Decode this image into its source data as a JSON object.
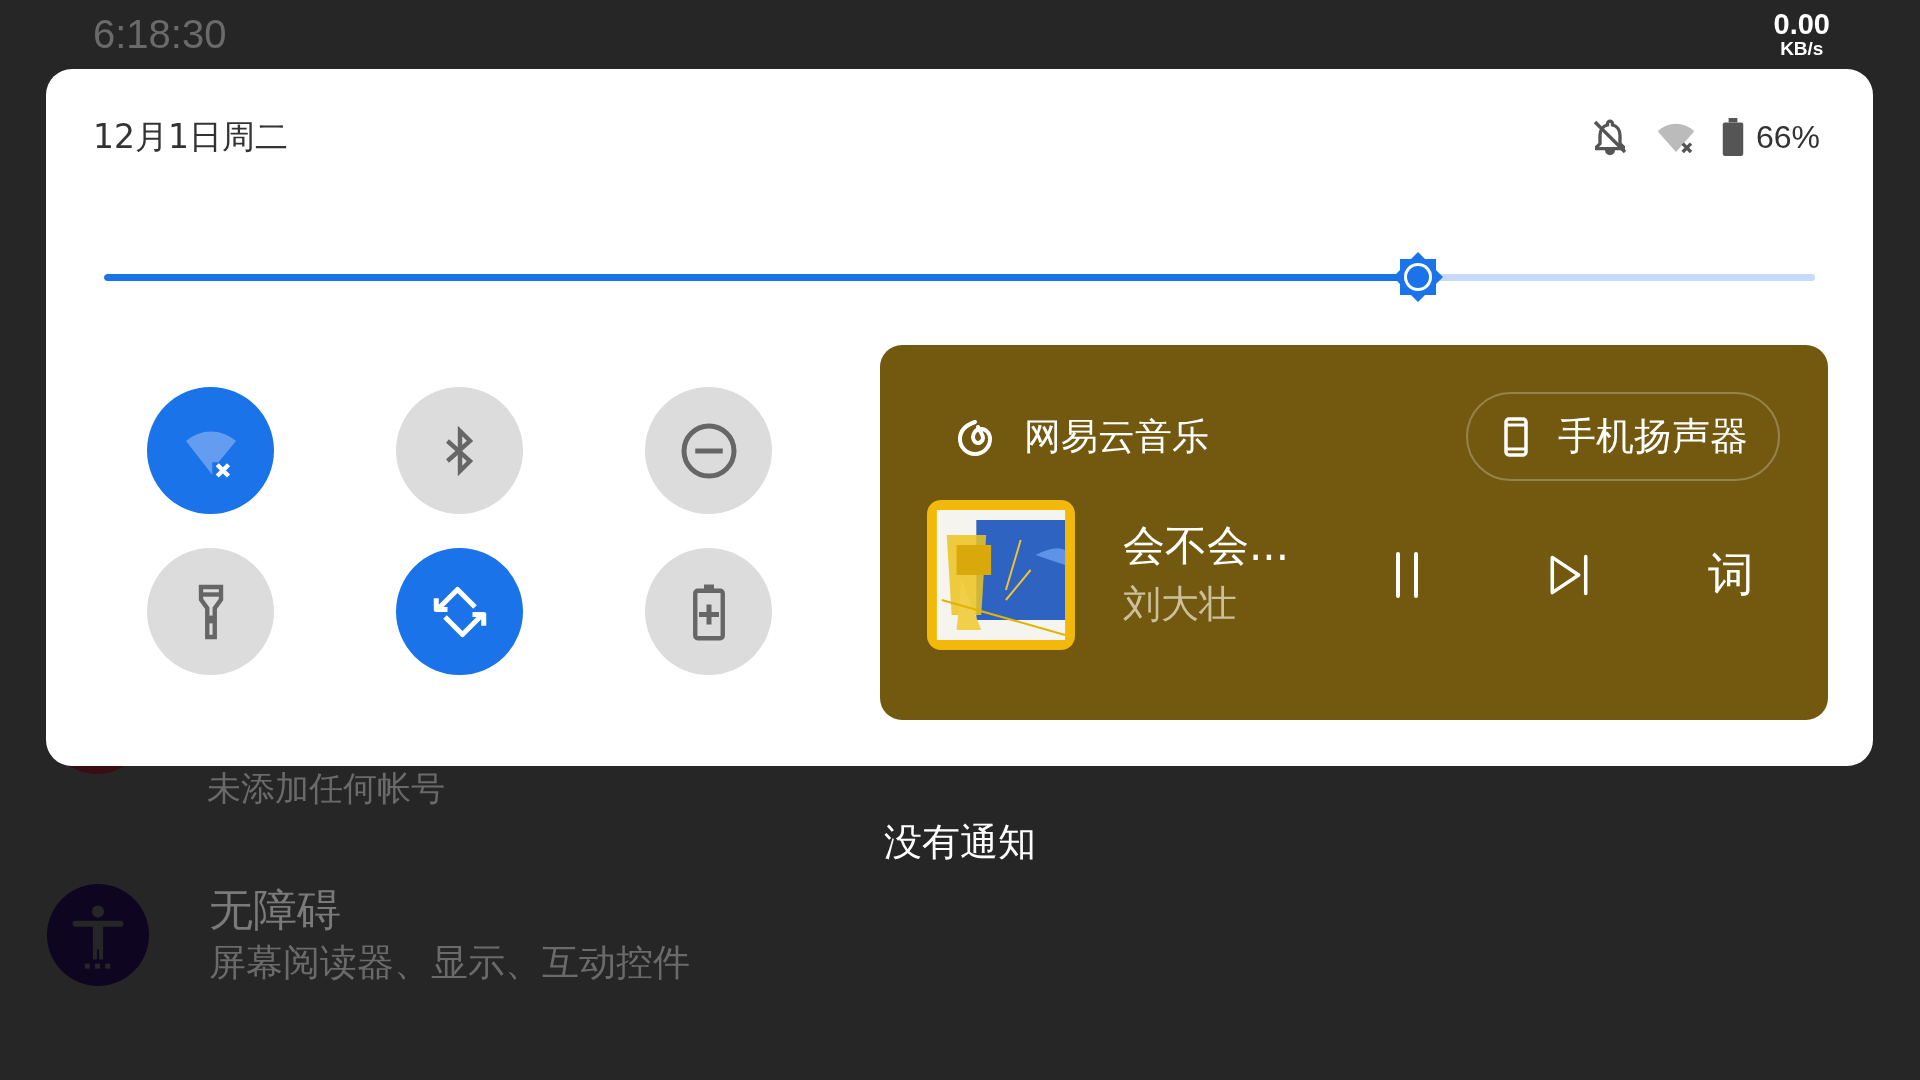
{
  "status_bar": {
    "time": "6:18:30",
    "net_speed": {
      "value": "0.00",
      "unit": "KB/s"
    }
  },
  "quick_settings": {
    "date": "12月1日周二",
    "battery_text": "66%",
    "brightness": {
      "level": 0.768
    },
    "tiles": [
      {
        "kind": "wifi",
        "on": true
      },
      {
        "kind": "bluetooth",
        "on": false
      },
      {
        "kind": "do-not-disturb",
        "on": false
      },
      {
        "kind": "flashlight",
        "on": false
      },
      {
        "kind": "auto-rotate",
        "on": true
      },
      {
        "kind": "battery-saver",
        "on": false
      }
    ],
    "media": {
      "app_name": "网易云音乐",
      "output": "手机扬声器",
      "title": "会不会...",
      "artist": "刘大壮",
      "lyrics_button": "词",
      "playing": true
    }
  },
  "background": {
    "accounts_subtitle": "未添加任何帐号",
    "empty_notifications": "没有通知",
    "accessibility": {
      "title": "无障碍",
      "subtitle": "屏幕阅读器、显示、互动控件"
    }
  }
}
